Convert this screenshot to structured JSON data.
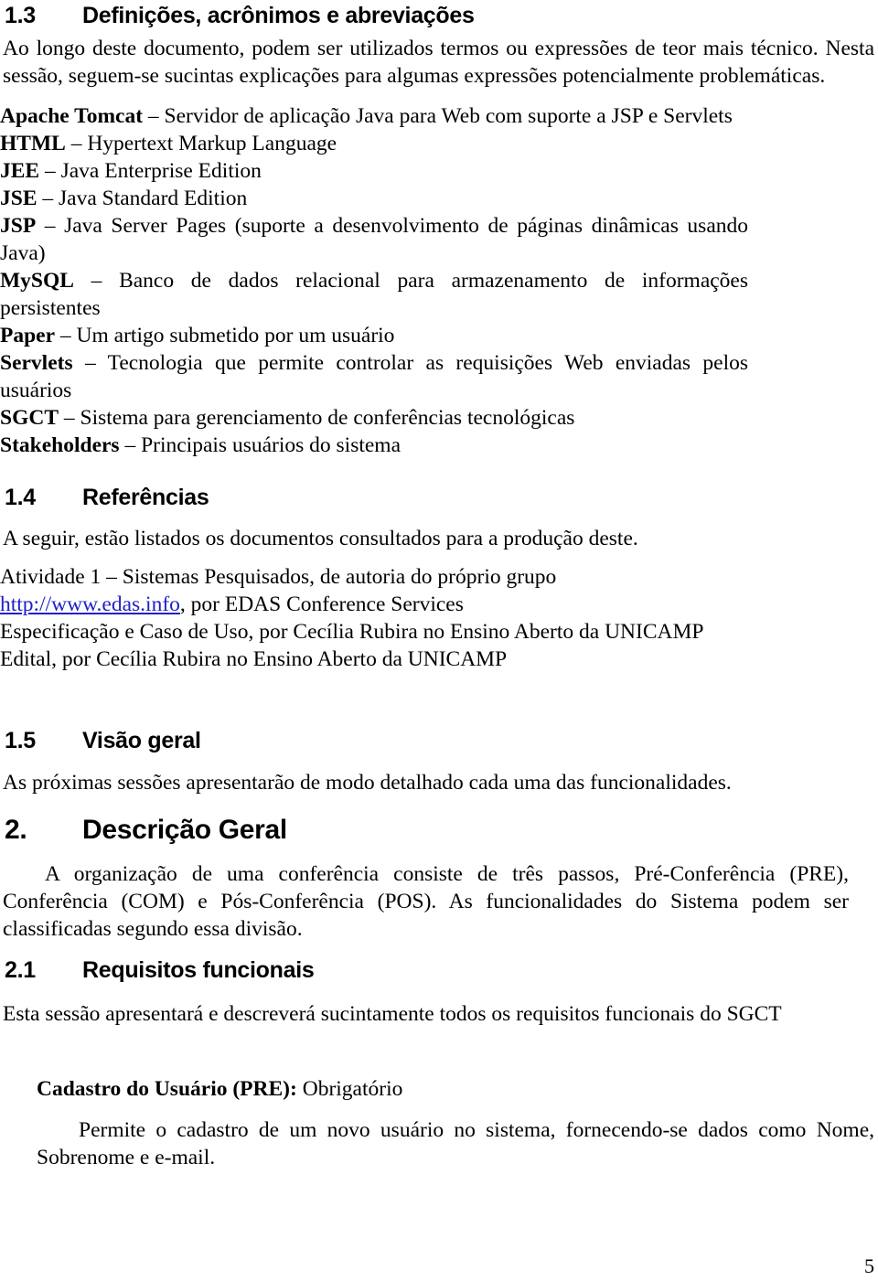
{
  "document": {
    "page_number": "5"
  },
  "sections": {
    "definitions": {
      "number": "1.3",
      "title": "Definições, acrônimos e abreviações",
      "intro": "Ao longo deste documento, podem ser utilizados termos ou expressões de teor mais técnico. Nesta sessão, seguem-se sucintas explicações para algumas expressões potencialmente problemáticas.",
      "items": [
        {
          "term": "Apache Tomcat",
          "dash": " – ",
          "definition": "Servidor de aplicação Java para Web com suporte a JSP e Servlets"
        },
        {
          "term": "HTML",
          "dash": " – ",
          "definition": "Hypertext Markup Language"
        },
        {
          "term": "JEE",
          "dash": " – ",
          "definition": "Java Enterprise Edition"
        },
        {
          "term": "JSE",
          "dash": " – ",
          "definition": "Java Standard Edition"
        },
        {
          "term": "JSP",
          "dash": " – ",
          "definition": "Java Server Pages (suporte a desenvolvimento de páginas dinâmicas usando Java)"
        },
        {
          "term": "MySQL",
          "dash": " – ",
          "definition": "Banco de dados relacional para armazenamento de informações persistentes"
        },
        {
          "term": "Paper",
          "dash": " – ",
          "definition": "Um artigo submetido por um usuário"
        },
        {
          "term": "Servlets",
          "dash": " – ",
          "definition": "Tecnologia que permite controlar as requisições Web enviadas pelos usuários"
        },
        {
          "term": "SGCT",
          "dash": " – ",
          "definition": "Sistema para gerenciamento de conferências tecnológicas"
        },
        {
          "term": "Stakeholders",
          "dash": " – ",
          "definition": "Principais usuários do sistema"
        }
      ]
    },
    "references": {
      "number": "1.4",
      "title": "Referências",
      "intro": "A seguir, estão listados os documentos consultados para a produção deste.",
      "items": [
        {
          "text": "Atividade 1 – Sistemas Pesquisados, de autoria do próprio grupo",
          "link": null,
          "after": null
        },
        {
          "text": null,
          "link": "http://www.edas.info",
          "after": ", por EDAS Conference Services"
        },
        {
          "text": "Especificação e Caso de Uso, por Cecília Rubira no Ensino Aberto da UNICAMP",
          "link": null,
          "after": null
        },
        {
          "text": "Edital, por Cecília Rubira no Ensino Aberto da UNICAMP",
          "link": null,
          "after": null
        }
      ],
      "link_color": "#2020C8"
    },
    "overview": {
      "number": "1.5",
      "title": "Visão geral",
      "body": "As próximas sessões apresentarão de modo detalhado cada uma das funcionalidades."
    },
    "general_description": {
      "number": "2.",
      "title": "Descrição Geral",
      "body": "A organização de uma conferência consiste de três passos, Pré-Conferência (PRE), Conferência (COM) e Pós-Conferência (POS). As funcionalidades do Sistema podem ser classificadas segundo essa divisão."
    },
    "functional_requirements": {
      "number": "2.1",
      "title": "Requisitos funcionais",
      "intro": "Esta sessão apresentará e descreverá sucintamente todos os requisitos funcionais do SGCT",
      "requirement": {
        "heading_bold": "Cadastro do Usuário (PRE):",
        "heading_rest": " Obrigatório",
        "body": "Permite o cadastro de um novo usuário no sistema, fornecendo-se dados como Nome, Sobrenome e e-mail."
      }
    }
  }
}
